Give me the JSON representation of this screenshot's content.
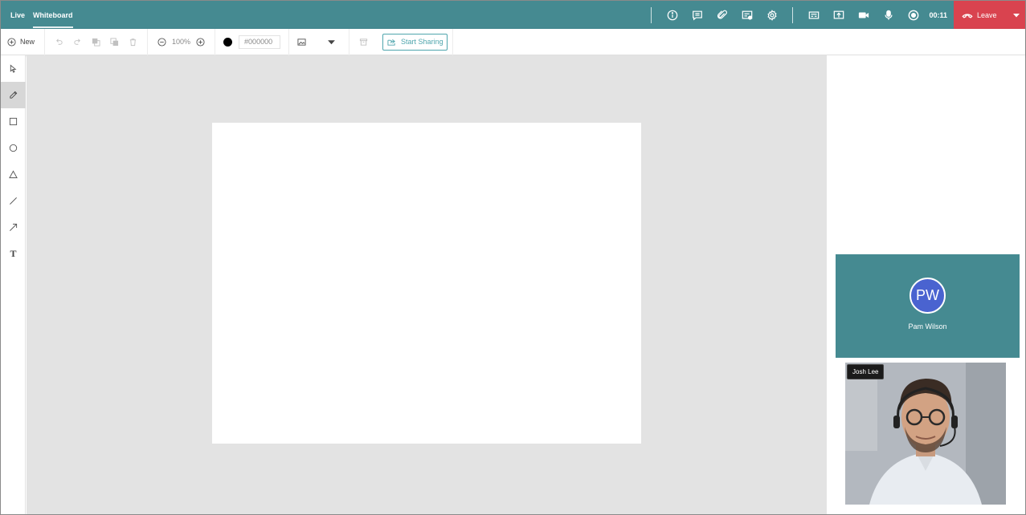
{
  "header": {
    "tabs": [
      {
        "label": "Live"
      },
      {
        "label": "Whiteboard"
      }
    ],
    "timer": "00:11",
    "leave_label": "Leave",
    "icons": [
      "info-icon",
      "chat-icon",
      "attachment-icon",
      "notes-icon",
      "settings-icon",
      "captions-icon",
      "screen-share-icon",
      "camera-icon",
      "microphone-icon",
      "record-icon",
      "phone-hangup-icon",
      "caret-down-icon"
    ],
    "colors": {
      "bar": "#458a91",
      "leave": "#d9434f"
    }
  },
  "toolbar": {
    "new_label": "New",
    "zoom": "100%",
    "color_value": "#000000",
    "selected_color": "#000000",
    "share_label": "Start Sharing",
    "share_color": "#4fa5ad"
  },
  "tools": [
    {
      "name": "select",
      "icon": "cursor-icon"
    },
    {
      "name": "pencil",
      "icon": "pencil-icon",
      "active": true
    },
    {
      "name": "rectangle",
      "icon": "square-icon"
    },
    {
      "name": "circle",
      "icon": "circle-icon"
    },
    {
      "name": "triangle",
      "icon": "triangle-icon"
    },
    {
      "name": "line",
      "icon": "line-icon"
    },
    {
      "name": "arrow",
      "icon": "arrow-icon"
    },
    {
      "name": "text",
      "icon": "text-icon",
      "glyph": "T"
    }
  ],
  "participants": [
    {
      "name": "Pam Wilson",
      "initials": "PW",
      "avatar_color": "#4a63d0"
    },
    {
      "name": "Josh Lee",
      "video": true
    }
  ]
}
